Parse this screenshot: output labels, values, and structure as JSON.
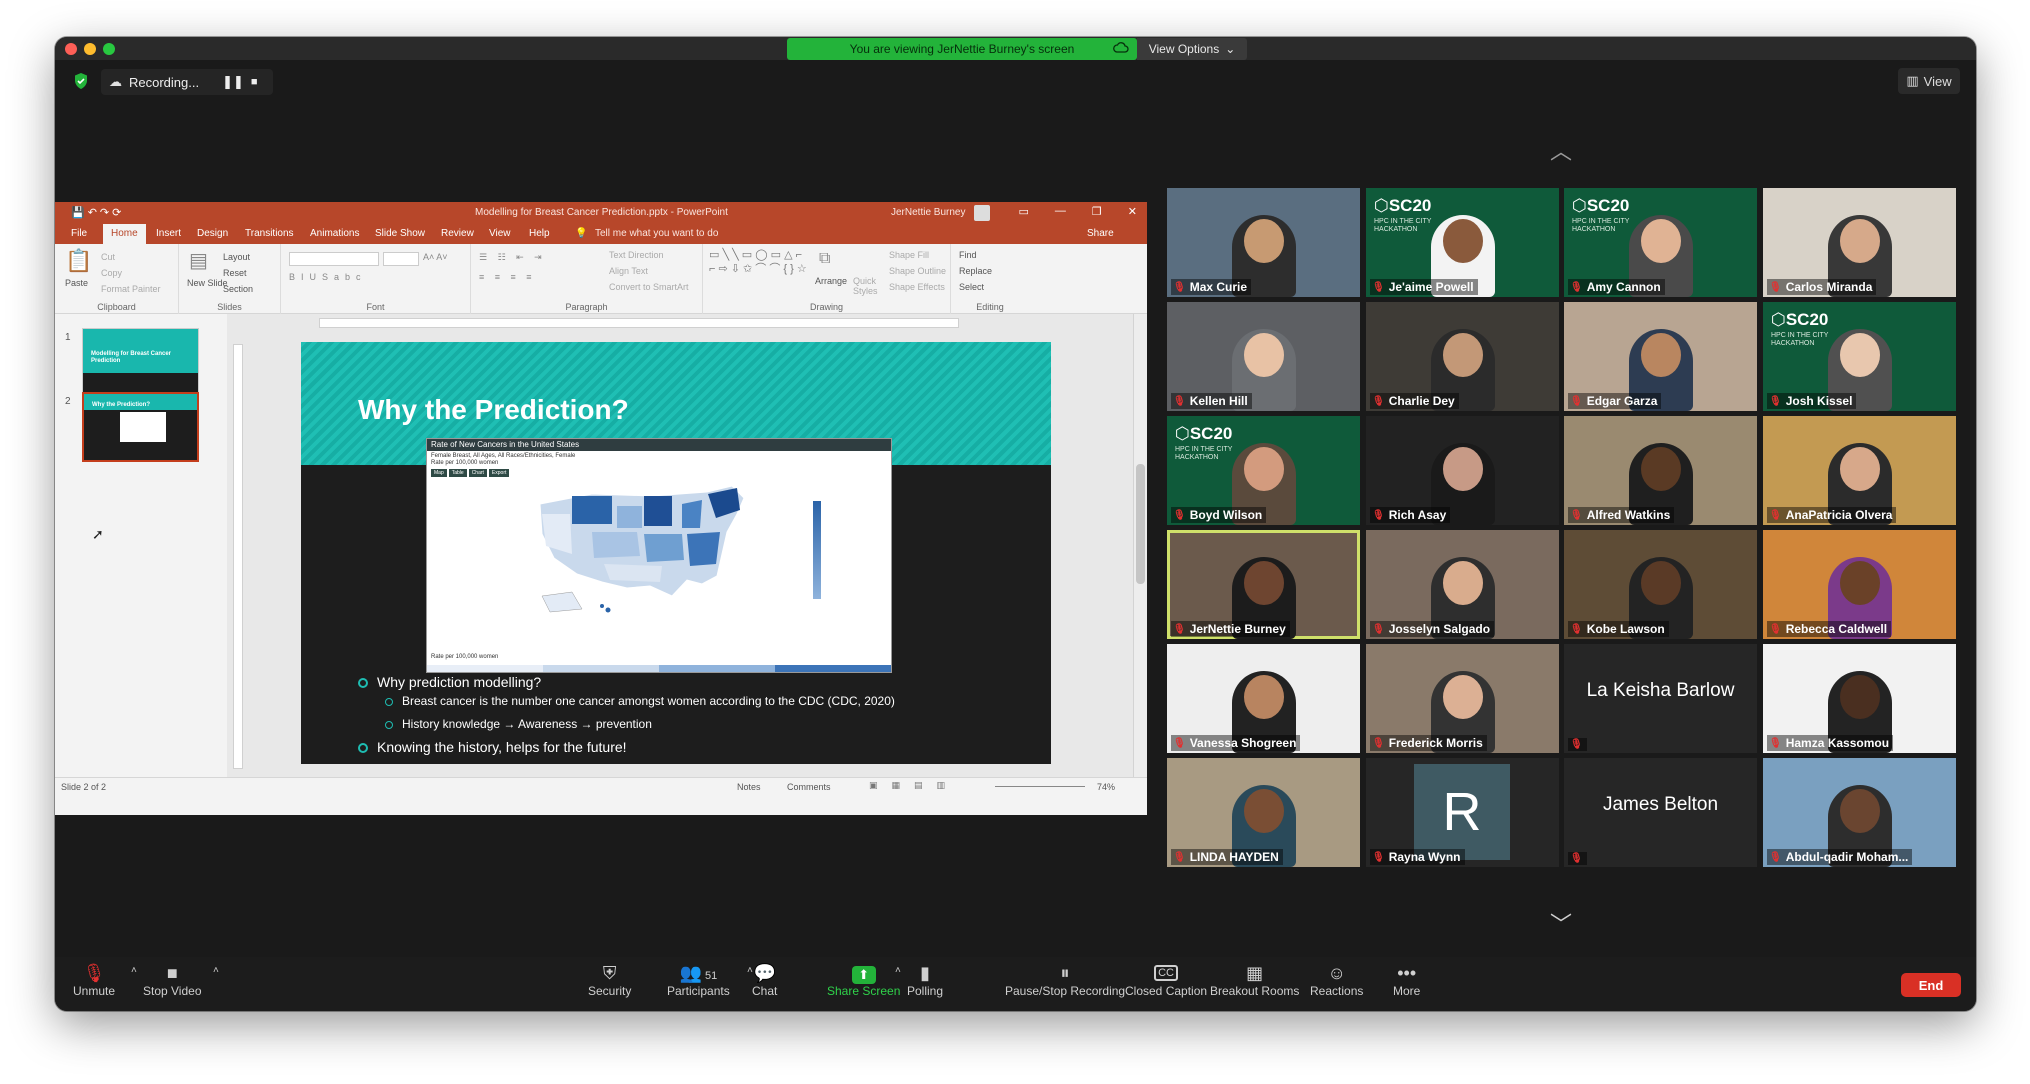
{
  "window": {
    "banner": "You are viewing JerNettie Burney's screen",
    "view_options": "View Options",
    "recording_label": "Recording...",
    "view_button": "View"
  },
  "ppt": {
    "title": "Modelling for Breast Cancer Prediction.pptx - PowerPoint",
    "user": "JerNettie Burney",
    "tabs": [
      "File",
      "Home",
      "Insert",
      "Design",
      "Transitions",
      "Animations",
      "Slide Show",
      "Review",
      "View",
      "Help"
    ],
    "tell_me": "Tell me what you want to do",
    "share": "Share",
    "ribbon": {
      "clipboard": {
        "paste": "Paste",
        "cut": "Cut",
        "copy": "Copy",
        "format_painter": "Format Painter",
        "label": "Clipboard"
      },
      "slides": {
        "new_slide": "New Slide",
        "layout": "Layout",
        "reset": "Reset",
        "section": "Section",
        "label": "Slides"
      },
      "font": {
        "label": "Font"
      },
      "paragraph": {
        "text_direction": "Text Direction",
        "align_text": "Align Text",
        "smartart": "Convert to SmartArt",
        "label": "Paragraph"
      },
      "drawing": {
        "arrange": "Arrange",
        "quick_styles": "Quick Styles",
        "shape_fill": "Shape Fill",
        "shape_outline": "Shape Outline",
        "shape_effects": "Shape Effects",
        "label": "Drawing"
      },
      "editing": {
        "find": "Find",
        "replace": "Replace",
        "select": "Select",
        "label": "Editing"
      }
    },
    "thumbs": [
      {
        "num": "1",
        "title": "Modelling for Breast Cancer Prediction"
      },
      {
        "num": "2",
        "title": "Why the Prediction?"
      }
    ],
    "slide": {
      "title": "Why the Prediction?",
      "map_header": "Rate of New Cancers in the United States",
      "map_sub1": "Female Breast, All Ages, All Races/Ethnicities, Female",
      "map_sub2": "Rate per 100,000 women",
      "map_buttons": [
        "Map",
        "Table",
        "Chart",
        "Export"
      ],
      "map_rate": "Rate per 100,000 women",
      "bullets": [
        {
          "level": 1,
          "text": "Why prediction modelling?"
        },
        {
          "level": 2,
          "text": "Breast cancer is the number one cancer amongst women according to the CDC (CDC, 2020)"
        },
        {
          "level": 2,
          "text": "History knowledge → Awareness → prevention"
        },
        {
          "level": 1,
          "text": "Knowing the history, helps for the future!"
        }
      ]
    },
    "status": {
      "slide": "Slide 2 of 2",
      "notes": "Notes",
      "comments": "Comments",
      "zoom": "74%"
    }
  },
  "participants": [
    {
      "name": "Max Curie",
      "type": "video",
      "bg": "#5a6e80",
      "skin": "#c79a72",
      "shirt": "#2d2d2d"
    },
    {
      "name": "Je'aime Powell",
      "type": "sc20",
      "skin": "#8a5a3c",
      "shirt": "#f3f3f3"
    },
    {
      "name": "Amy Cannon",
      "type": "sc20",
      "skin": "#e0b394",
      "shirt": "#4a4a4a"
    },
    {
      "name": "Carlos Miranda",
      "type": "video",
      "bg": "#d8d2c8",
      "skin": "#d6a98a",
      "shirt": "#383838"
    },
    {
      "name": "Kellen Hill",
      "type": "video",
      "bg": "#5d5f63",
      "skin": "#e8c2a5",
      "shirt": "#6b6e72"
    },
    {
      "name": "Charlie Dey",
      "type": "video",
      "bg": "#3e3b36",
      "skin": "#c39877",
      "shirt": "#2b2b2b"
    },
    {
      "name": "Edgar Garza",
      "type": "video",
      "bg": "#b8a592",
      "skin": "#b98660",
      "shirt": "#2d3c52"
    },
    {
      "name": "Josh Kissel",
      "type": "sc20",
      "skin": "#e8c7ae",
      "shirt": "#505050"
    },
    {
      "name": "Boyd Wilson",
      "type": "sc20",
      "skin": "#d39b7e",
      "shirt": "#5a4a3c"
    },
    {
      "name": "Rich Asay",
      "type": "video",
      "bg": "#222222",
      "skin": "#c79a86",
      "shirt": "#1a1a1a"
    },
    {
      "name": "Alfred Watkins",
      "type": "video",
      "bg": "#9a8a70",
      "skin": "#5a3a24",
      "shirt": "#1f1f1f"
    },
    {
      "name": "AnaPatricia Olvera",
      "type": "video",
      "bg": "#c39a52",
      "skin": "#d7a88a",
      "shirt": "#2b2b2b"
    },
    {
      "name": "JerNettie Burney",
      "type": "video",
      "bg": "#6b5a4c",
      "skin": "#6e4530",
      "shirt": "#1c1c1c"
    },
    {
      "name": "Josselyn Salgado",
      "type": "video",
      "bg": "#7a6a5e",
      "skin": "#d9ac8d",
      "shirt": "#2e2e2e"
    },
    {
      "name": "Kobe Lawson",
      "type": "video",
      "bg": "#5e4c36",
      "skin": "#5a3a26",
      "shirt": "#232323"
    },
    {
      "name": "Rebecca Caldwell",
      "type": "video",
      "bg": "#d0863a",
      "skin": "#6a4128",
      "shirt": "#7b3a8a"
    },
    {
      "name": "Vanessa Shogreen",
      "type": "video",
      "bg": "#eeeeee",
      "skin": "#b88460",
      "shirt": "#222222"
    },
    {
      "name": "Frederick Morris",
      "type": "video",
      "bg": "#8a7a6a",
      "skin": "#dcb094",
      "shirt": "#333333"
    },
    {
      "name": "La Keisha Barlow",
      "type": "text",
      "label": "La Keisha Barlow"
    },
    {
      "name": "Hamza Kassomou",
      "type": "video",
      "bg": "#f2f2f2",
      "skin": "#4a2f20",
      "shirt": "#232323"
    },
    {
      "name": "LINDA HAYDEN",
      "type": "video",
      "bg": "#a89a82",
      "skin": "#7a4e34",
      "shirt": "#2a4a5a"
    },
    {
      "name": "Rayna Wynn",
      "type": "initial",
      "label": "R"
    },
    {
      "name": "James Belton",
      "type": "text",
      "label": "James Belton"
    },
    {
      "name": "Abdul-qadir Moham...",
      "type": "video",
      "bg": "#7aa0c0",
      "skin": "#6a4530",
      "shirt": "#2d2d2d"
    }
  ],
  "toolbar": [
    {
      "id": "unmute",
      "label": "Unmute",
      "icon": "mic-off-icon",
      "glyph": "🎙"
    },
    {
      "id": "stop-video",
      "label": "Stop Video",
      "icon": "camera-icon",
      "glyph": "■"
    },
    {
      "id": "security",
      "label": "Security",
      "icon": "shield-icon",
      "glyph": "⛨"
    },
    {
      "id": "participants",
      "label": "Participants",
      "icon": "people-icon",
      "glyph": "👥",
      "count": "51"
    },
    {
      "id": "chat",
      "label": "Chat",
      "icon": "chat-icon",
      "glyph": "💬"
    },
    {
      "id": "share-screen",
      "label": "Share Screen",
      "icon": "share-icon",
      "glyph": "⬆"
    },
    {
      "id": "polling",
      "label": "Polling",
      "icon": "poll-icon",
      "glyph": "▮"
    },
    {
      "id": "pause-rec",
      "label": "Pause/Stop Recording",
      "icon": "pause-icon",
      "glyph": "⏸"
    },
    {
      "id": "cc",
      "label": "Closed Caption",
      "icon": "cc-icon",
      "glyph": "CC"
    },
    {
      "id": "breakout",
      "label": "Breakout Rooms",
      "icon": "grid-icon",
      "glyph": "▦"
    },
    {
      "id": "reactions",
      "label": "Reactions",
      "icon": "smile-icon",
      "glyph": "☺"
    },
    {
      "id": "more",
      "label": "More",
      "icon": "dots-icon",
      "glyph": "•••"
    }
  ],
  "end_label": "End",
  "colors": {
    "accent_green": "#23b33a",
    "ppt_red": "#b7472a",
    "teal": "#1fbfb4",
    "end_red": "#d93025",
    "speaker_outline": "#cfe06a"
  }
}
